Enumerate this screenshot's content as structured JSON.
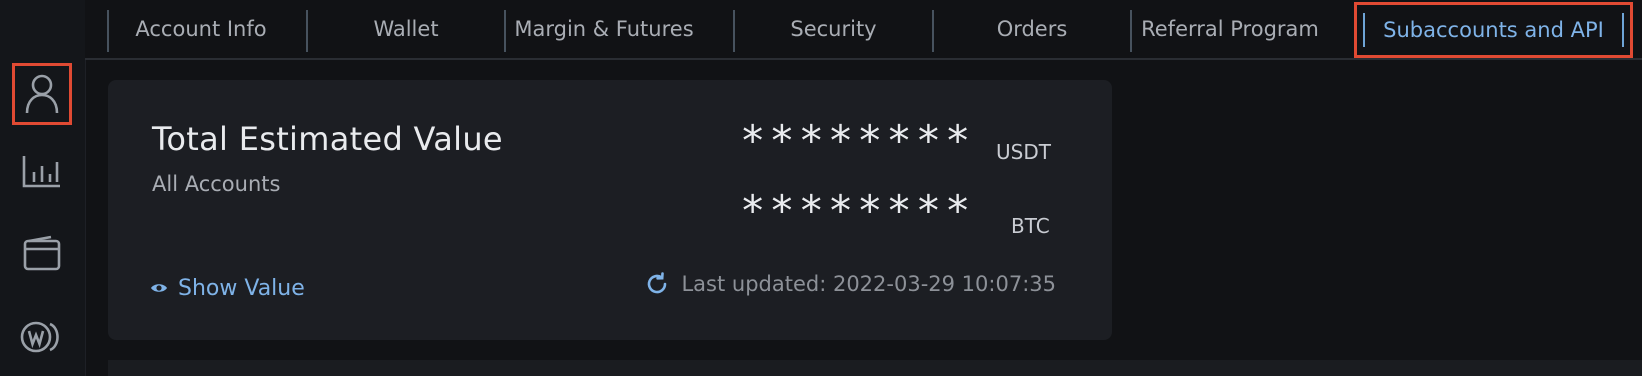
{
  "tabs": [
    {
      "label": "Account Info"
    },
    {
      "label": "Wallet"
    },
    {
      "label": "Margin & Futures"
    },
    {
      "label": "Security"
    },
    {
      "label": "Orders"
    },
    {
      "label": "Referral Program"
    },
    {
      "label": "Subaccounts and API",
      "active": true
    }
  ],
  "sidebar": {
    "items": [
      {
        "icon": "user-icon",
        "highlighted": true
      },
      {
        "icon": "bar-chart-icon"
      },
      {
        "icon": "wallet-icon"
      },
      {
        "icon": "w-logo-icon"
      }
    ]
  },
  "summary": {
    "title": "Total Estimated Value",
    "subtitle": "All Accounts",
    "usdt_value": "********",
    "usdt_label": "USDT",
    "btc_value": "********",
    "btc_label": "BTC",
    "show_value_label": "Show Value",
    "last_updated": "Last updated: 2022-03-29 10:07:35"
  },
  "colors": {
    "accent": "#7fb3e8",
    "highlight_border": "#e04a33",
    "card_bg": "#1c1e23",
    "page_bg": "#111215"
  }
}
